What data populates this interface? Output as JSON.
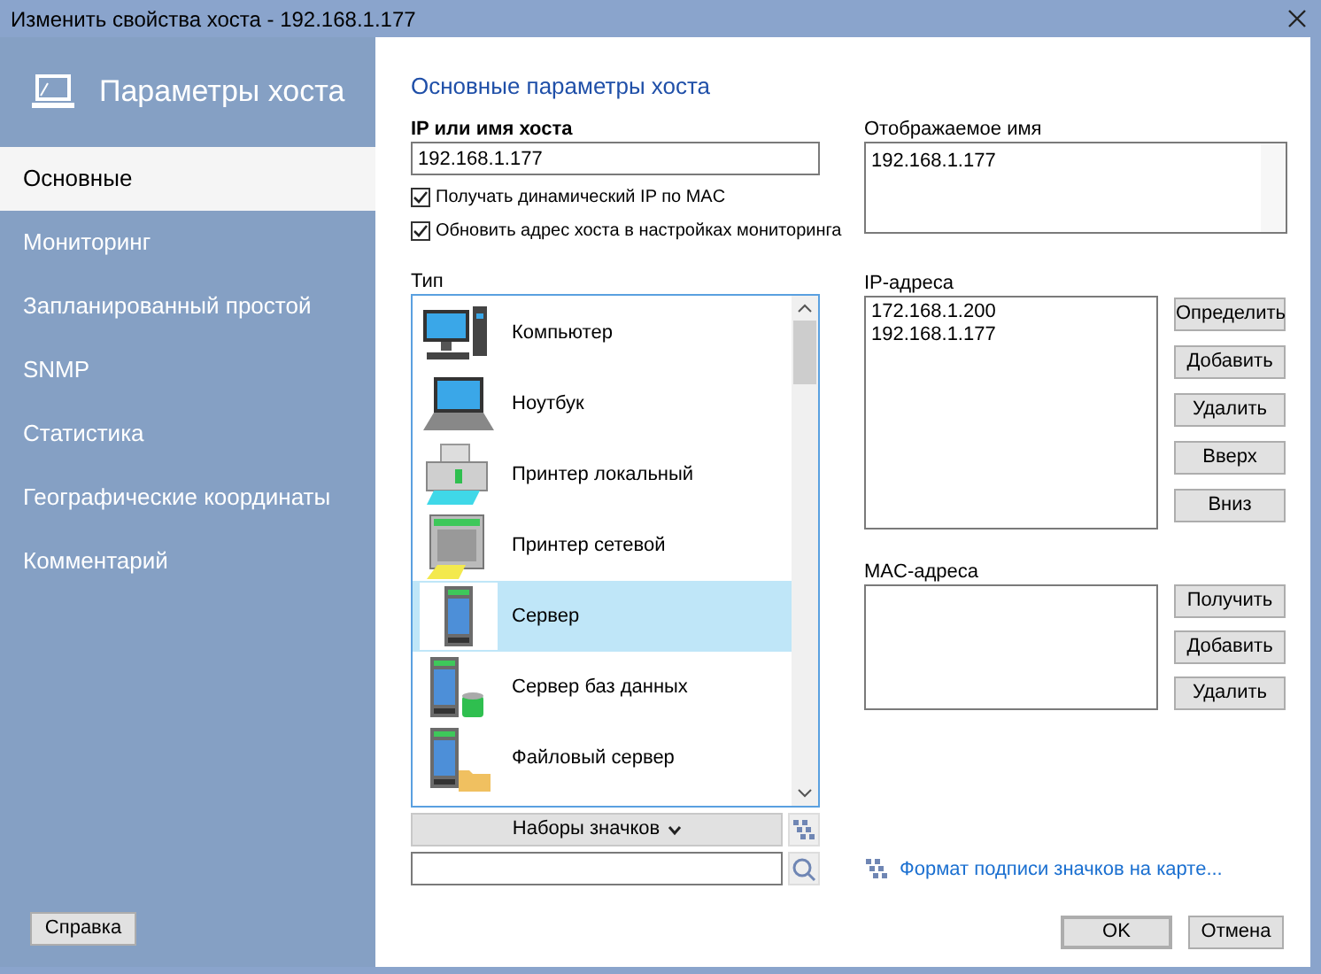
{
  "window": {
    "title": "Изменить свойства хоста - 192.168.1.177"
  },
  "sidebar": {
    "title": "Параметры хоста",
    "items": [
      {
        "label": "Основные",
        "selected": true
      },
      {
        "label": "Мониторинг",
        "selected": false
      },
      {
        "label": "Запланированный простой",
        "selected": false
      },
      {
        "label": "SNMP",
        "selected": false
      },
      {
        "label": "Статистика",
        "selected": false
      },
      {
        "label": "Географические координаты",
        "selected": false
      },
      {
        "label": "Комментарий",
        "selected": false
      }
    ],
    "help_button": "Справка"
  },
  "section_title": "Основные параметры хоста",
  "host": {
    "label": "IP или имя хоста",
    "value": "192.168.1.177"
  },
  "options": [
    {
      "label": "Получать динамический IP по MAC",
      "checked": true
    },
    {
      "label": "Обновить адрес хоста в настройках мониторинга",
      "checked": true
    }
  ],
  "type": {
    "label": "Тип",
    "items": [
      {
        "kind": "computer",
        "label": "Компьютер",
        "selected": false
      },
      {
        "kind": "laptop",
        "label": "Ноутбук",
        "selected": false
      },
      {
        "kind": "printer",
        "label": "Принтер локальный",
        "selected": false
      },
      {
        "kind": "network_printer",
        "label": "Принтер сетевой",
        "selected": false
      },
      {
        "kind": "server",
        "label": "Сервер",
        "selected": true
      },
      {
        "kind": "db_server",
        "label": "Сервер баз данных",
        "selected": false
      },
      {
        "kind": "file_server",
        "label": "Файловый сервер",
        "selected": false
      }
    ],
    "icon_sets_button": "Наборы значков"
  },
  "display_name": {
    "label": "Отображаемое имя",
    "value": "192.168.1.177"
  },
  "ip_addresses": {
    "label": "IP-адреса",
    "items": [
      "172.168.1.200",
      "192.168.1.177"
    ],
    "buttons": [
      "Определить",
      "Добавить",
      "Удалить",
      "Вверх",
      "Вниз"
    ]
  },
  "mac_addresses": {
    "label": "MAC-адреса",
    "buttons": [
      "Получить",
      "Добавить",
      "Удалить"
    ]
  },
  "label_format_link": "Формат подписи значков на карте...",
  "buttons": {
    "ok": "OK",
    "cancel": "Отмена"
  }
}
